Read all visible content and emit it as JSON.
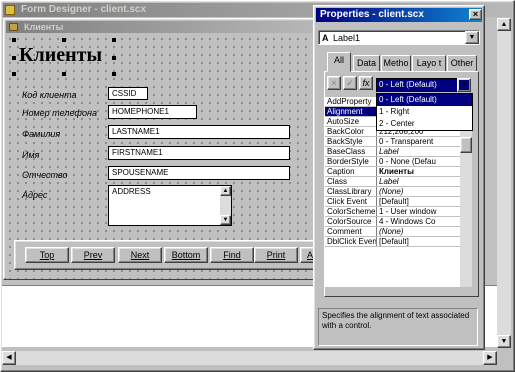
{
  "form_designer": {
    "title": "Form Designer - client.scx"
  },
  "form": {
    "title": "Клиенты",
    "heading": "Клиенты",
    "fields": [
      {
        "label": "Код клиента",
        "value": "CSSID"
      },
      {
        "label": "Номер телефона",
        "value": "HOMEPHONE1"
      },
      {
        "label": "Фамилия",
        "value": "LASTNAME1"
      },
      {
        "label": "Имя",
        "value": "FIRSTNAME1"
      },
      {
        "label": "Отчество",
        "value": "SPOUSENAME"
      },
      {
        "label": "Адрес",
        "value": "ADDRESS"
      }
    ],
    "nav_buttons": [
      "Top",
      "Prev",
      "Next",
      "Bottom",
      "Find",
      "Print",
      "A"
    ]
  },
  "properties": {
    "title": "Properties - client.scx",
    "object_select": "Label1",
    "tabs": [
      "All",
      "Data",
      "Metho",
      "Layo t",
      "Other"
    ],
    "value_field": "0 - Left (Default)",
    "dropdown_options": [
      "0 - Left (Default)",
      "1 - Right",
      "2 - Center"
    ],
    "rows": [
      {
        "name": "AddProperty",
        "value": ""
      },
      {
        "name": "Alignment",
        "value": ""
      },
      {
        "name": "AutoSize",
        "value": ""
      },
      {
        "name": "BackColor",
        "value": "212,208,200"
      },
      {
        "name": "BackStyle",
        "value": "0 - Transparent"
      },
      {
        "name": "BaseClass",
        "value": "Label"
      },
      {
        "name": "BorderStyle",
        "value": "0 - None (Defau"
      },
      {
        "name": "Caption",
        "value": "Клиенты"
      },
      {
        "name": "Class",
        "value": "Label"
      },
      {
        "name": "ClassLibrary",
        "value": "(None)"
      },
      {
        "name": "Click Event",
        "value": "[Default]"
      },
      {
        "name": "ColorScheme",
        "value": "1 - User window"
      },
      {
        "name": "ColorSource",
        "value": "4 - Windows Co"
      },
      {
        "name": "Comment",
        "value": "(None)"
      },
      {
        "name": "DblClick Event",
        "value": "[Default]"
      }
    ],
    "description": "Specifies the alignment of text associated with a control."
  }
}
